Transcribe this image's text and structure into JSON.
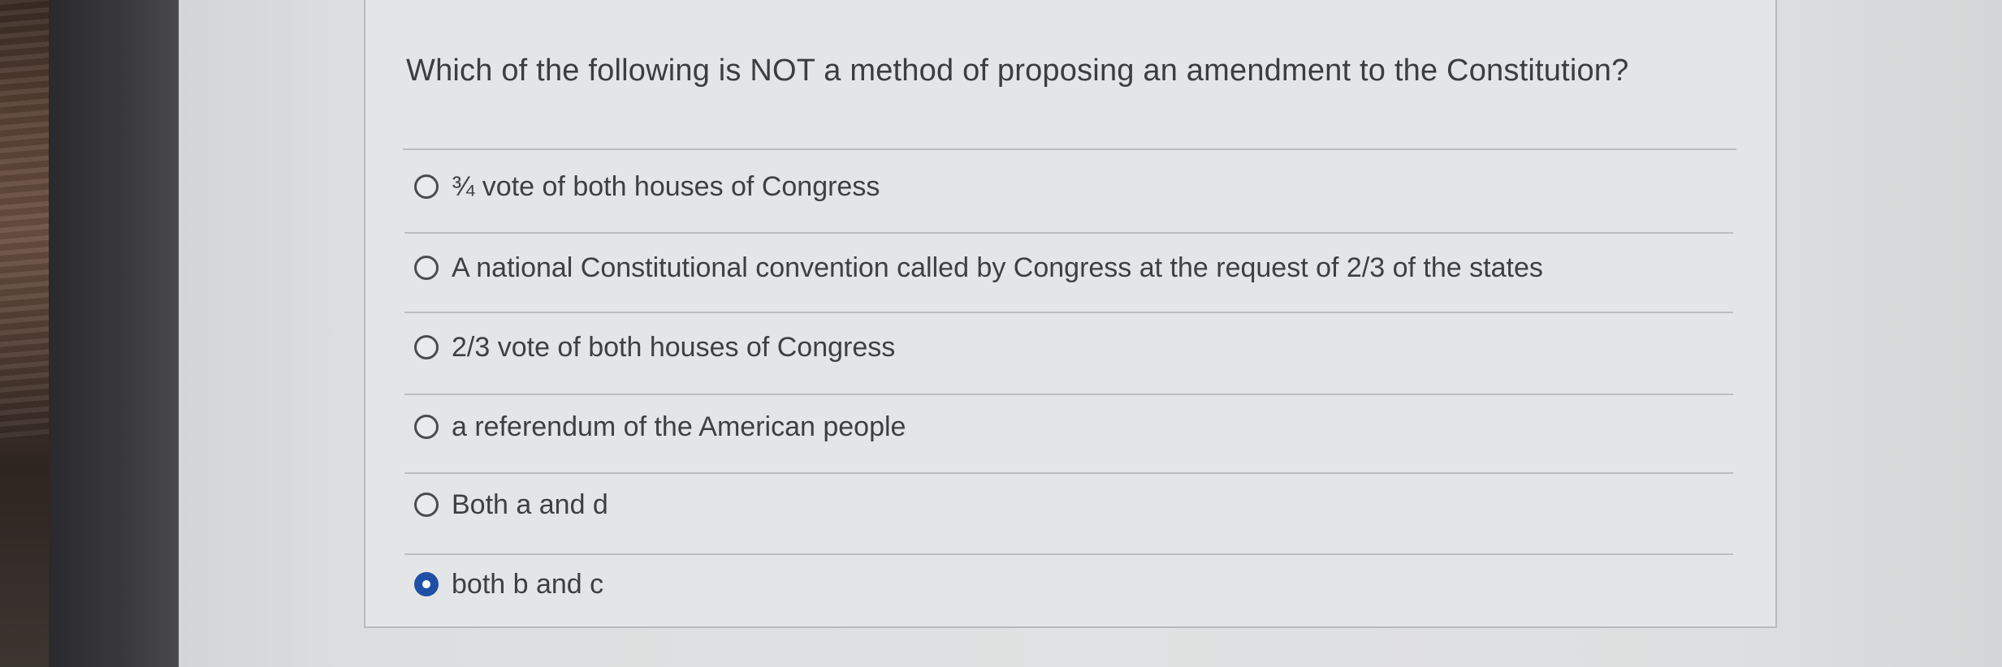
{
  "quiz": {
    "question": "Which of the following is NOT a method of proposing an amendment to the Constitution?",
    "options": [
      {
        "label": "¾ vote of both houses of Congress",
        "selected": false
      },
      {
        "label": "A national Constitutional convention called by Congress at the request of 2/3 of the states",
        "selected": false
      },
      {
        "label": "2/3 vote of both houses of Congress",
        "selected": false
      },
      {
        "label": "a referendum of the American people",
        "selected": false
      },
      {
        "label": "Both a and d",
        "selected": false
      },
      {
        "label": "both b and c",
        "selected": true
      }
    ]
  },
  "colors": {
    "selected_radio": "#1f4fa7",
    "text": "#3e3f41",
    "divider": "#bcbec0"
  },
  "icons": {
    "unselected": "radio-unselected-icon",
    "selected": "radio-selected-icon"
  }
}
